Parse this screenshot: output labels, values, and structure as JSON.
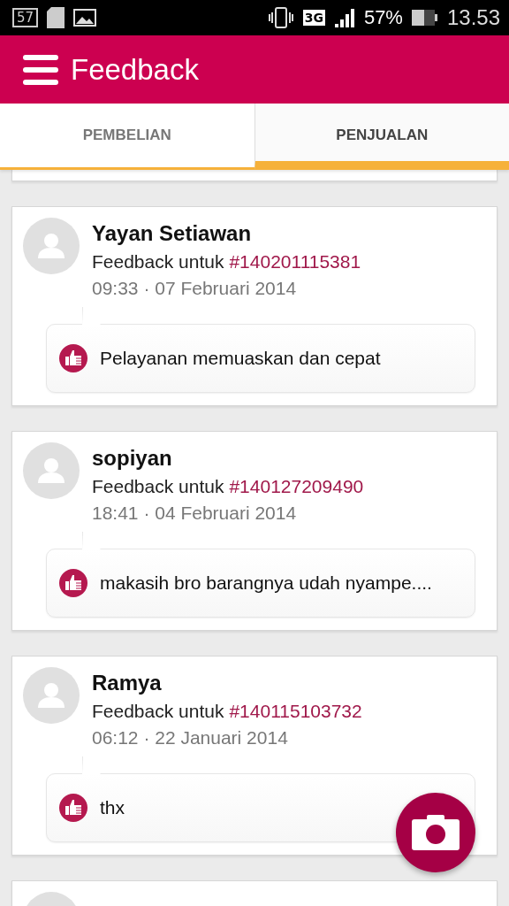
{
  "status_bar": {
    "notification_badge": "57",
    "network": "3G",
    "battery": "57%",
    "time": "13.53"
  },
  "app_bar": {
    "title": "Feedback"
  },
  "tabs": [
    {
      "label": "PEMBELIAN",
      "selected": false
    },
    {
      "label": "PENJUALAN",
      "selected": true
    }
  ],
  "feedbacks": [
    {
      "name": "Yayan Setiawan",
      "prefix": "Feedback untuk",
      "order": "#140201115381",
      "time": "09:33 · 07 Februari 2014",
      "positive": true,
      "comment": "Pelayanan memuaskan dan cepat"
    },
    {
      "name": "sopiyan",
      "prefix": "Feedback untuk",
      "order": "#140127209490",
      "time": "18:41 · 04 Februari 2014",
      "positive": true,
      "comment": "makasih bro barangnya udah nyampe...."
    },
    {
      "name": "Ramya",
      "prefix": "Feedback untuk",
      "order": "#140115103732",
      "time": "06:12 · 22 Januari 2014",
      "positive": true,
      "comment": "thx"
    }
  ]
}
